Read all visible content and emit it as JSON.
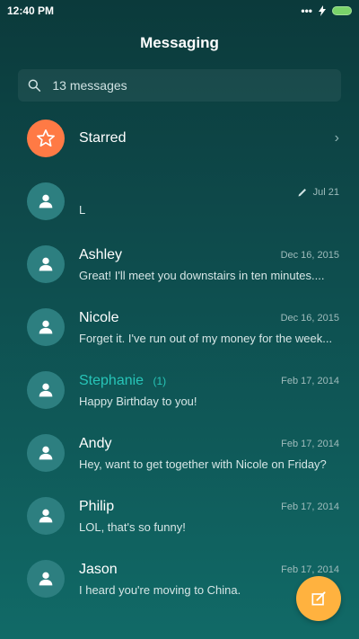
{
  "status": {
    "time": "12:40 PM"
  },
  "header": {
    "title": "Messaging"
  },
  "search": {
    "placeholder": "13 messages"
  },
  "starred": {
    "label": "Starred"
  },
  "conversations": [
    {
      "name": "",
      "date": "Jul 21",
      "preview": "L"
    },
    {
      "name": "Ashley",
      "date": "Dec 16, 2015",
      "preview": "Great! I'll meet you downstairs in ten minutes...."
    },
    {
      "name": "Nicole",
      "date": "Dec 16, 2015",
      "preview": "Forget it. I've run out of my money for the week..."
    },
    {
      "name": "Stephanie",
      "badge": "(1)",
      "date": "Feb 17, 2014",
      "preview": "Happy Birthday to you!"
    },
    {
      "name": "Andy",
      "date": "Feb 17, 2014",
      "preview": "Hey, want to get together with Nicole on Friday?"
    },
    {
      "name": "Philip",
      "date": "Feb 17, 2014",
      "preview": "LOL, that's so funny!"
    },
    {
      "name": "Jason",
      "date": "Feb 17, 2014",
      "preview": "I heard you're moving to China."
    }
  ],
  "colors": {
    "accent": "#27c5b8",
    "fab": "#ffb23f",
    "starred_avatar": "#ff7a45"
  },
  "icons": {
    "search": "search-icon",
    "star": "star-icon",
    "compose": "compose-icon",
    "draft": "pencil-icon"
  }
}
